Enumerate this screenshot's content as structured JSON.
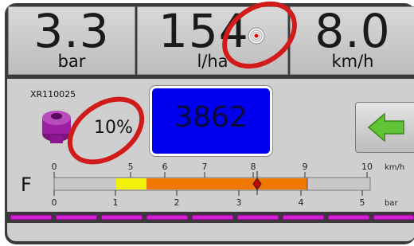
{
  "top_tiles": [
    {
      "value": "3.3",
      "unit": "bar"
    },
    {
      "value": "154",
      "unit": "l/ha"
    },
    {
      "value": "8.0",
      "unit": "km/h"
    }
  ],
  "nozzle": {
    "name": "XR110025",
    "percent": "10%",
    "color": "#9b1fa0"
  },
  "target_rate_display": "3862",
  "gauge": {
    "label": "F",
    "speed_unit": "km/h",
    "pressure_unit": "bar",
    "top_ticks": [
      "0",
      "5",
      "6",
      "7",
      "8",
      "9",
      "10"
    ],
    "bottom_ticks": [
      "0",
      "1",
      "2",
      "3",
      "4",
      "5"
    ],
    "colors": {
      "yellow": "#f2f20a",
      "orange": "#f07800",
      "grey": "#c8c8c8",
      "marker": "#cc0000"
    }
  },
  "annotation_color": "#d11a1a",
  "section_color": "#d020d0"
}
